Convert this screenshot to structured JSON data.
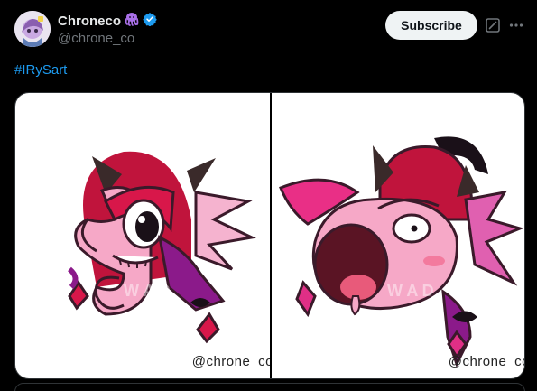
{
  "author": {
    "display_name": "Chroneco",
    "handle": "@chrone_co",
    "name_emoji": "octopus-icon",
    "verified": true
  },
  "actions": {
    "subscribe_label": "Subscribe",
    "grok_icon": "grok-icon",
    "more_icon": "more-icon"
  },
  "post": {
    "hashtag": "#IRySart"
  },
  "media": {
    "images": [
      {
        "description_icon": "irys-seahorse-art",
        "credit": "@chrone_co",
        "watermark": "W A D"
      },
      {
        "description_icon": "irys-shocked-art",
        "credit": "@chrone_co",
        "watermark": "W A D"
      }
    ]
  },
  "colors": {
    "background": "#000000",
    "text": "#e7e9ea",
    "secondary_text": "#71767b",
    "link": "#1d9bf0",
    "verified": "#1d9bf0",
    "octopus": "#a970e8"
  }
}
